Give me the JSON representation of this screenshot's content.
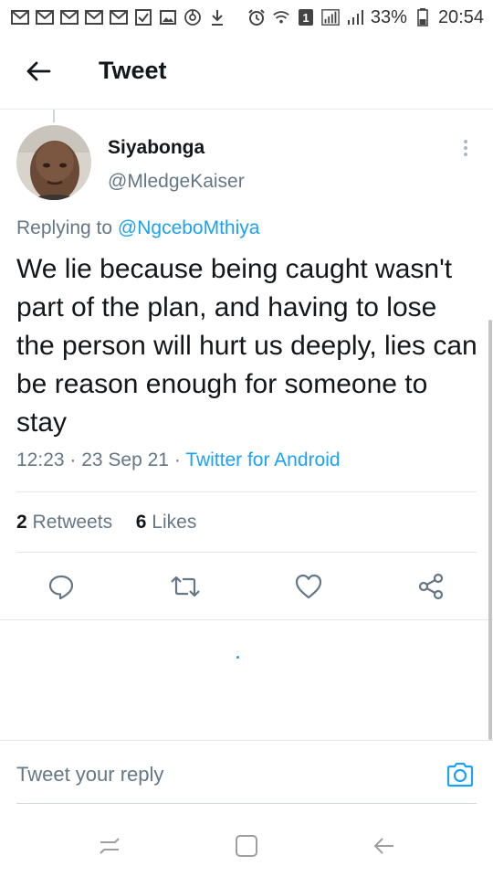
{
  "status_bar": {
    "battery": "33%",
    "time": "20:54",
    "sim_badge": "1",
    "left_icons": [
      "gmail-icon",
      "gmail-icon",
      "gmail-icon",
      "gmail-icon",
      "gmail-icon",
      "checkbox-icon",
      "gallery-icon",
      "sync-icon",
      "download-icon"
    ],
    "right_icons": [
      "alarm-icon",
      "wifi-icon",
      "sim-icon",
      "signal-icon",
      "signal-icon",
      "battery-icon"
    ]
  },
  "header": {
    "title": "Tweet",
    "back_icon": "arrow-left-icon"
  },
  "tweet": {
    "display_name": "Siyabonga",
    "handle": "@MledgeKaiser",
    "replying_prefix": "Replying to",
    "replying_to": "@NgceboMthiya",
    "text": "We lie because being caught wasn't part of the plan, and having to lose the person will hurt us deeply, lies can be reason enough for someone to stay",
    "time": "12:23",
    "date": "23 Sep 21",
    "source": "Twitter for Android",
    "retweets_count": "2",
    "retweets_label": "Retweets",
    "likes_count": "6",
    "likes_label": "Likes",
    "action_icons": [
      "reply-icon",
      "retweet-icon",
      "like-icon",
      "share-icon"
    ]
  },
  "reply": {
    "placeholder": "Tweet your reply",
    "camera_icon": "camera-icon"
  },
  "nav_bar": {
    "icons": [
      "recents-icon",
      "home-icon",
      "back-icon"
    ]
  },
  "colors": {
    "accent": "#1da1f2",
    "text_primary": "#14171a",
    "text_secondary": "#657786",
    "divider": "#e1e8ed"
  }
}
